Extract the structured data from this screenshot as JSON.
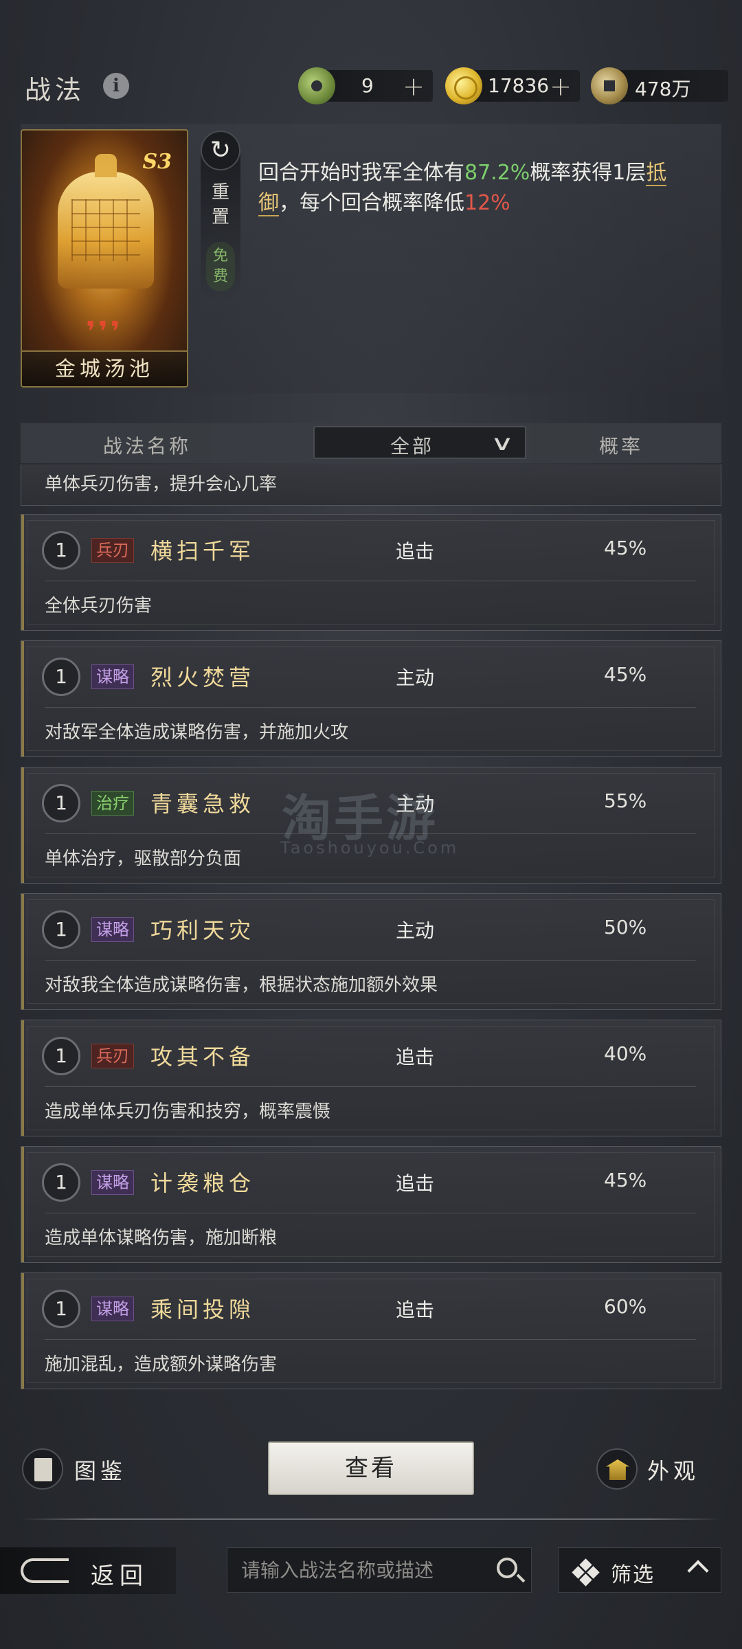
{
  "header": {
    "title": "战法",
    "info_icon": "i",
    "currencies": [
      {
        "name": "jade",
        "value": "9",
        "plus": "+"
      },
      {
        "name": "gold",
        "value": "17836",
        "plus": "+"
      },
      {
        "name": "copper",
        "value": "478万"
      }
    ]
  },
  "skill": {
    "card_name": "金城汤池",
    "grade": "S3",
    "quality_marks": "❜❜❜",
    "reset_label": "重置",
    "reset_free": "免费",
    "reset_icon": "↻",
    "desc_part1": "回合开始时我军全体有",
    "desc_rate": "87.2%",
    "desc_part2": "概率获得1层",
    "desc_keyword": "抵御",
    "desc_part3": "，每个回合概率降低",
    "desc_decay": "12%"
  },
  "list_header": {
    "name_col": "战法名称",
    "filter_value": "全部",
    "filter_icon": "∨",
    "rate_col": "概率"
  },
  "list": {
    "partial_desc": "单体兵刃伤害，提升会心几率",
    "items": [
      {
        "level": "1",
        "tag": "兵刃",
        "name": "横扫千军",
        "type": "追击",
        "rate": "45%",
        "desc": "全体兵刃伤害"
      },
      {
        "level": "1",
        "tag": "谋略",
        "name": "烈火焚营",
        "type": "主动",
        "rate": "45%",
        "desc": "对敌军全体造成谋略伤害，并施加火攻"
      },
      {
        "level": "1",
        "tag": "治疗",
        "name": "青囊急救",
        "type": "主动",
        "rate": "55%",
        "desc": "单体治疗，驱散部分负面"
      },
      {
        "level": "1",
        "tag": "谋略",
        "name": "巧利天灾",
        "type": "主动",
        "rate": "50%",
        "desc": "对敌我全体造成谋略伤害，根据状态施加额外效果"
      },
      {
        "level": "1",
        "tag": "兵刃",
        "name": "攻其不备",
        "type": "追击",
        "rate": "40%",
        "desc": "造成单体兵刃伤害和技穷，概率震慑"
      },
      {
        "level": "1",
        "tag": "谋略",
        "name": "计袭粮仓",
        "type": "追击",
        "rate": "45%",
        "desc": "造成单体谋略伤害，施加断粮"
      },
      {
        "level": "1",
        "tag": "谋略",
        "name": "乘间投隙",
        "type": "追击",
        "rate": "60%",
        "desc": "施加混乱，造成额外谋略伤害"
      }
    ]
  },
  "bottom": {
    "book_label": "图鉴",
    "view_label": "查看",
    "look_label": "外观"
  },
  "footer": {
    "back_label": "返回",
    "search_placeholder": "请输入战法名称或描述",
    "filter_label": "筛选"
  },
  "watermark": {
    "main": "淘手游",
    "sub": "Taoshouyou.Com"
  }
}
